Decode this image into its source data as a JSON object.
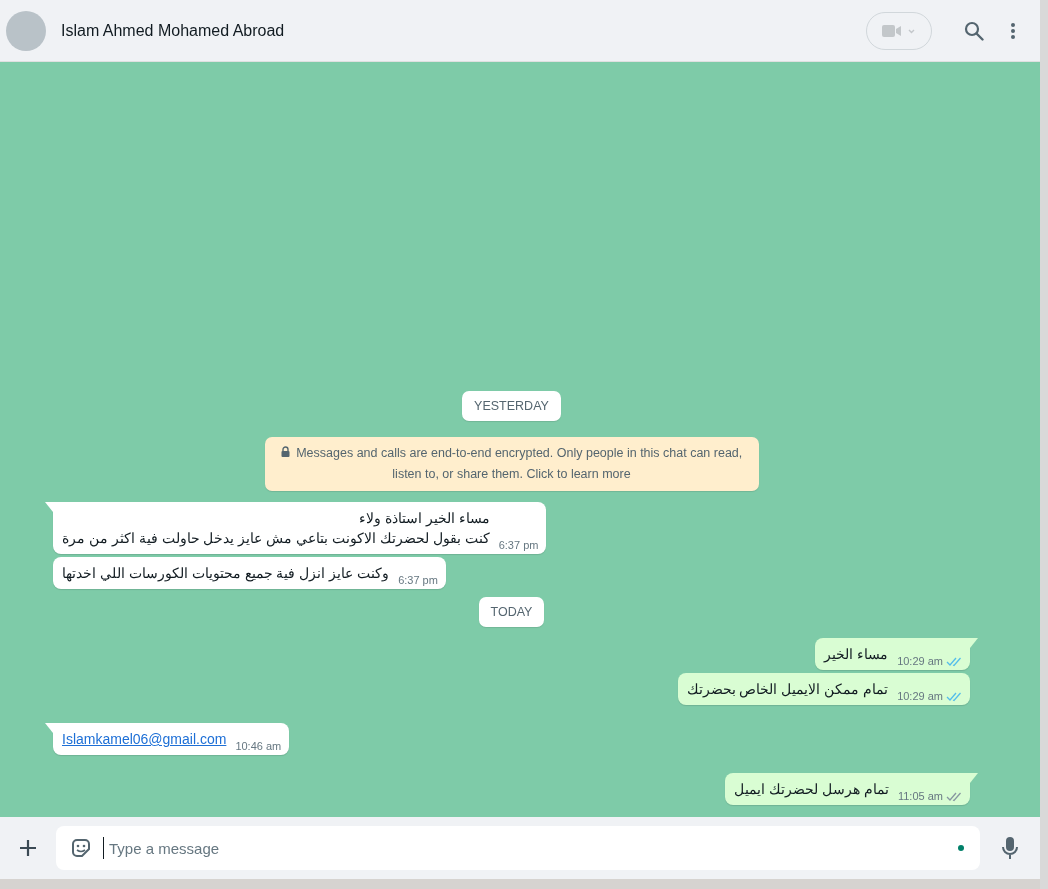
{
  "header": {
    "contact_name": "Islam Ahmed Mohamed Abroad"
  },
  "messages": [
    {
      "kind": "date",
      "text": "YESTERDAY"
    },
    {
      "kind": "system",
      "text": "Messages and calls are end-to-end encrypted. Only people in this chat can read, listen to, or share them. Click to learn more"
    },
    {
      "kind": "incoming",
      "lines": [
        "مساء الخير استاذة ولاء",
        "كنت بقول لحضرتك الاكونت بتاعي مش عايز يدخل حاولت فية اكثر من مرة"
      ],
      "time": "6:37 pm"
    },
    {
      "kind": "incoming",
      "lines": [
        "وكنت عايز انزل فية جميع محتويات الكورسات اللي اخدتها"
      ],
      "time": "6:37 pm"
    },
    {
      "kind": "date",
      "text": "TODAY"
    },
    {
      "kind": "outgoing",
      "lines": [
        "مساء الخير"
      ],
      "time": "10:29 am",
      "read": true
    },
    {
      "kind": "outgoing",
      "lines": [
        "تمام ممكن الايميل الخاص بحضرتك"
      ],
      "time": "10:29 am",
      "read": true
    },
    {
      "kind": "incoming",
      "link": "Islamkamel06@gmail.com",
      "time": "10:46 am"
    },
    {
      "kind": "outgoing",
      "lines": [
        "تمام هرسل لحضرتك ايميل"
      ],
      "time": "11:05 am",
      "read": false
    }
  ],
  "composer": {
    "placeholder": "Type a message"
  }
}
